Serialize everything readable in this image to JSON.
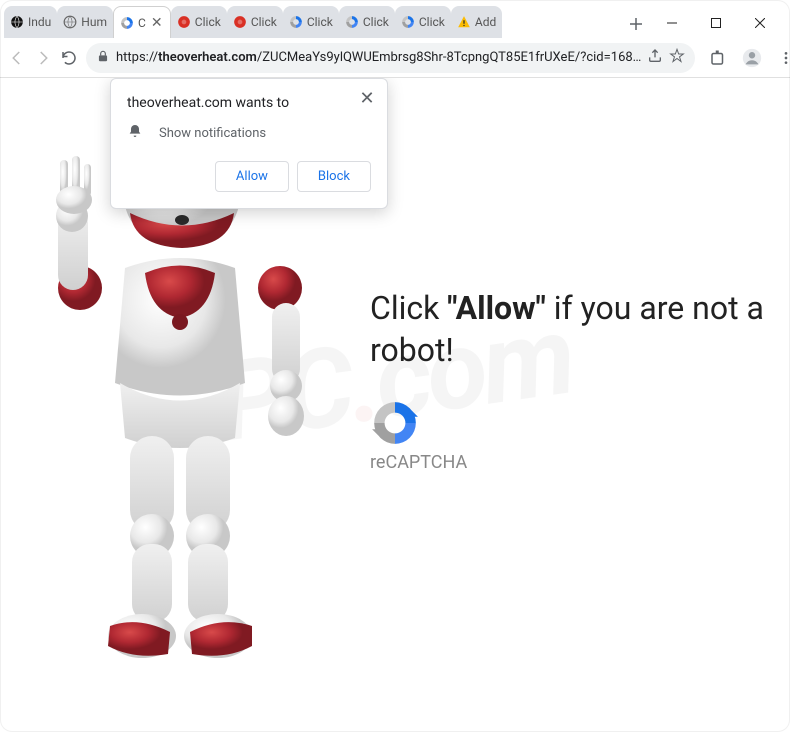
{
  "window": {
    "tabs": [
      {
        "label": "Indu",
        "icon": "globe-black"
      },
      {
        "label": "Hum",
        "icon": "globe-grey"
      },
      {
        "label": "C",
        "icon": "recaptcha",
        "active": true,
        "hasClose": true
      },
      {
        "label": "Click",
        "icon": "red-dot"
      },
      {
        "label": "Click",
        "icon": "red-dot"
      },
      {
        "label": "Click",
        "icon": "recaptcha"
      },
      {
        "label": "Click",
        "icon": "recaptcha"
      },
      {
        "label": "Click",
        "icon": "recaptcha"
      },
      {
        "label": "Add",
        "icon": "warning"
      }
    ],
    "controls": {
      "minimize": "–",
      "maximize": "☐",
      "close": "✕"
    }
  },
  "toolbar": {
    "url_prefix": "https://",
    "url_domain": "theoverheat.com",
    "url_path": "/ZUCMeaYs9ylQWUEmbrsg8Shr-8TcpngQT85E1frUXeE/?cid=168…"
  },
  "dialog": {
    "title": "theoverheat.com wants to",
    "permission": "Show notifications",
    "allow": "Allow",
    "block": "Block"
  },
  "page": {
    "message_prefix": "Click ",
    "message_bold": "\"Allow\"",
    "message_suffix": " if you are not a robot!",
    "recaptcha_label": "reCAPTCHA"
  },
  "watermark": {
    "t1": "PC",
    "dot": ".",
    "t2": "com"
  }
}
